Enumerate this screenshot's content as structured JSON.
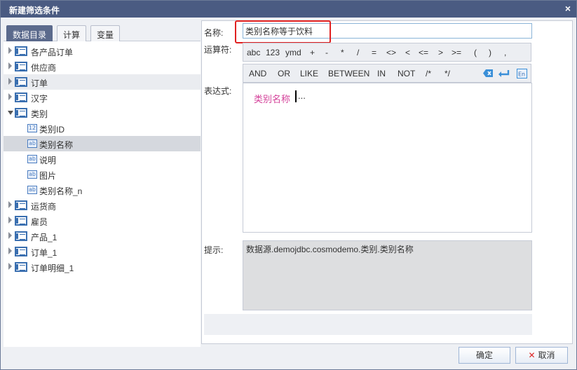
{
  "dialog": {
    "title": "新建筛选条件",
    "close_symbol": "×"
  },
  "tabs": [
    {
      "label": "数据目录",
      "active": true
    },
    {
      "label": "计算",
      "active": false
    },
    {
      "label": "变量",
      "active": false
    }
  ],
  "tree": [
    {
      "label": "各产品订单",
      "kind": "table",
      "expanded": false
    },
    {
      "label": "供应商",
      "kind": "table",
      "expanded": false
    },
    {
      "label": "订单",
      "kind": "table",
      "expanded": false
    },
    {
      "label": "汉字",
      "kind": "table",
      "expanded": false
    },
    {
      "label": "类别",
      "kind": "table",
      "expanded": true
    },
    {
      "label": "类别ID",
      "kind": "field",
      "field_type": "12",
      "selected": false
    },
    {
      "label": "类别名称",
      "kind": "field",
      "field_type": "ab",
      "selected": true
    },
    {
      "label": "说明",
      "kind": "field",
      "field_type": "ab",
      "selected": false
    },
    {
      "label": "图片",
      "kind": "field",
      "field_type": "ab",
      "selected": false
    },
    {
      "label": "类别名称_n",
      "kind": "field",
      "field_type": "ab",
      "selected": false
    },
    {
      "label": "运货商",
      "kind": "table",
      "expanded": false
    },
    {
      "label": "雇员",
      "kind": "table",
      "expanded": false
    },
    {
      "label": "产品_1",
      "kind": "table",
      "expanded": false
    },
    {
      "label": "订单_1",
      "kind": "table",
      "expanded": false
    },
    {
      "label": "订单明细_1",
      "kind": "table",
      "expanded": false
    }
  ],
  "form": {
    "name_label": "名称:",
    "name_value": "类别名称等于饮料",
    "operator_label": "运算符:",
    "expression_label": "表达式:",
    "hint_label": "提示:",
    "hint_text": "数据源.demojdbc.cosmodemo.类别.类别名称",
    "expression_token": "类别名称",
    "expression_trailing": "..."
  },
  "operators_row1": [
    "abc",
    "123",
    "ymd",
    "+",
    "-",
    "*",
    "/",
    "=",
    "<>",
    "<",
    "<=",
    ">",
    ">=",
    "(",
    ")",
    ","
  ],
  "operators_row2": [
    "AND",
    "OR",
    "LIKE",
    "BETWEEN",
    "IN",
    "NOT",
    "/*",
    "*/"
  ],
  "toolbar_icons": [
    "backspace-icon",
    "enter-icon",
    "english-input-icon"
  ],
  "toolbar_icon_text": {
    "english": "En"
  },
  "buttons": {
    "ok": "确定",
    "cancel": "取消",
    "cancel_symbol": "✕"
  },
  "colors": {
    "accent": "#4a5b82",
    "highlight": "#e02020",
    "token": "#d4429a"
  }
}
